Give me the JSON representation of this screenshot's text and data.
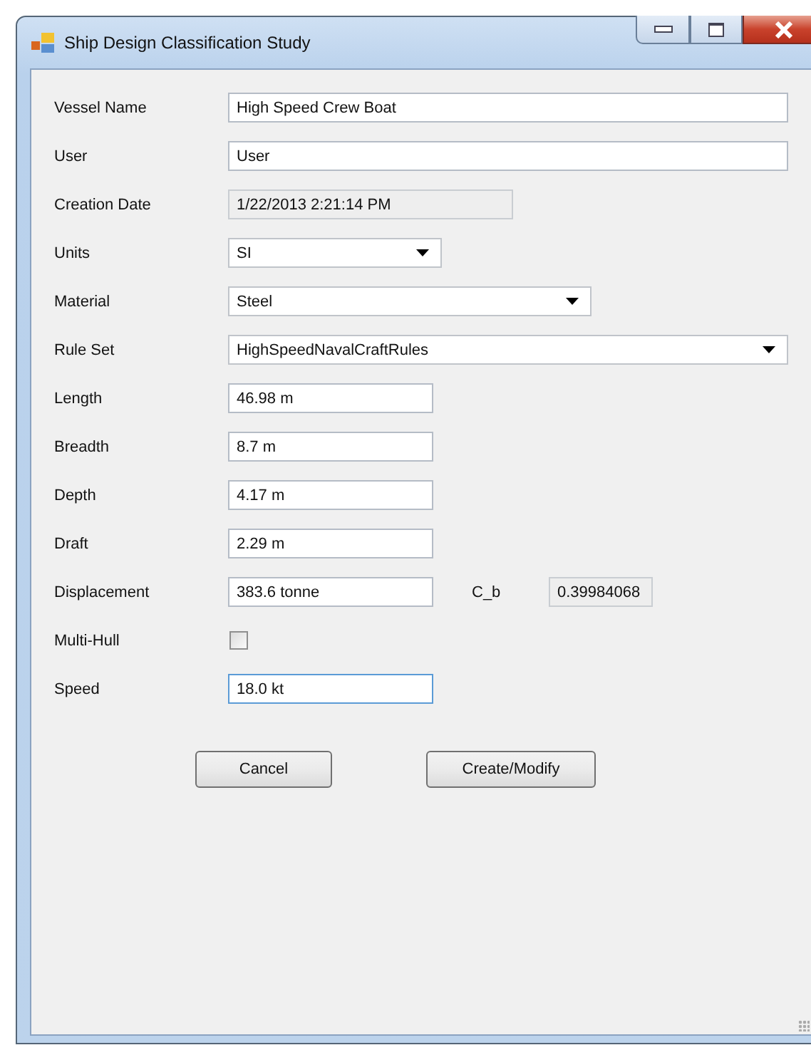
{
  "window": {
    "title": "Ship Design Classification Study"
  },
  "fields": [
    {
      "label": "Vessel Name",
      "kind": "text",
      "value": "High Speed Crew Boat",
      "focused": false
    },
    {
      "label": "User",
      "kind": "text",
      "value": "User",
      "focused": false
    },
    {
      "label": "Creation Date",
      "kind": "readonly",
      "value": "1/22/2013 2:21:14 PM"
    },
    {
      "label": "Units",
      "kind": "combo",
      "value": "SI"
    },
    {
      "label": "Material",
      "kind": "combo",
      "value": "Steel"
    },
    {
      "label": "Rule Set",
      "kind": "combo",
      "value": "HighSpeedNavalCraftRules"
    },
    {
      "label": "Length",
      "kind": "text",
      "value": "46.98 m",
      "focused": false
    },
    {
      "label": "Breadth",
      "kind": "text",
      "value": "8.7 m",
      "focused": false
    },
    {
      "label": "Depth",
      "kind": "text",
      "value": "4.17 m",
      "focused": false
    },
    {
      "label": "Draft",
      "kind": "text",
      "value": "2.29 m",
      "focused": false
    },
    {
      "label": "Displacement",
      "kind": "text",
      "value": "383.6 tonne",
      "focused": false,
      "extra": {
        "label": "C_b",
        "value": "0.39984068"
      }
    },
    {
      "label": "Multi-Hull",
      "kind": "checkbox",
      "checked": false
    },
    {
      "label": "Speed",
      "kind": "text",
      "value": "18.0 kt",
      "focused": true
    }
  ],
  "buttons": [
    "Cancel",
    "Create/Modify"
  ]
}
